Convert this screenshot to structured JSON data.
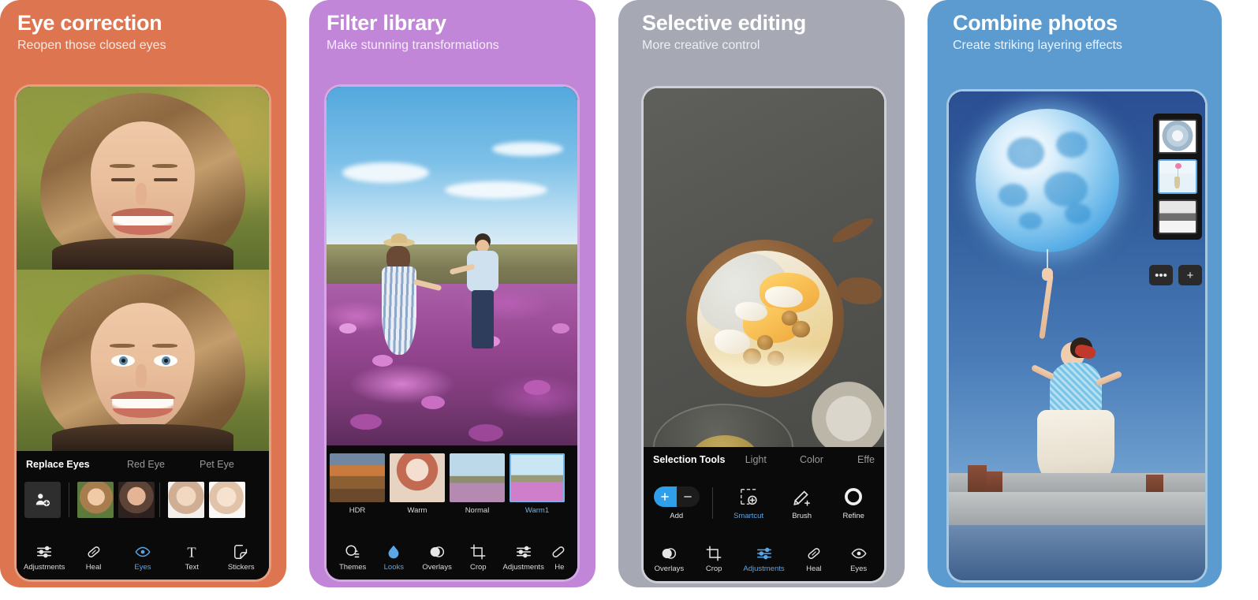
{
  "theme": {
    "card1_bg": "#dd7650",
    "card2_bg": "#c186d8",
    "card3_bg": "#a6a9b4",
    "card4_bg": "#5b9bd0",
    "accent_blue": "#5aa7e8",
    "panel_black": "#0a0a0a"
  },
  "cards": [
    {
      "id": "eye-correction",
      "title": "Eye correction",
      "subtitle": "Reopen those closed eyes",
      "tool_tabs": [
        {
          "label": "Replace Eyes",
          "active": true
        },
        {
          "label": "Red Eye",
          "active": false
        },
        {
          "label": "Pet Eye",
          "active": false
        }
      ],
      "add_button_icon": "add-person-icon",
      "thumbnails": [
        "face-thumb-1",
        "face-thumb-2",
        "face-thumb-3",
        "face-thumb-4"
      ],
      "nav": [
        {
          "label": "Adjustments",
          "icon": "sliders-icon",
          "selected": false
        },
        {
          "label": "Heal",
          "icon": "bandage-icon",
          "selected": false
        },
        {
          "label": "Eyes",
          "icon": "eye-icon",
          "selected": true
        },
        {
          "label": "Text",
          "icon": "text-icon",
          "selected": false
        },
        {
          "label": "Stickers",
          "icon": "sticker-icon",
          "selected": false
        }
      ]
    },
    {
      "id": "filter-library",
      "title": "Filter library",
      "subtitle": "Make stunning transformations",
      "filters": [
        {
          "label": "HDR",
          "selected": false
        },
        {
          "label": "Warm",
          "selected": false
        },
        {
          "label": "Normal",
          "selected": false
        },
        {
          "label": "Warm1",
          "selected": true
        }
      ],
      "nav": [
        {
          "label": "Themes",
          "icon": "themes-icon",
          "selected": false
        },
        {
          "label": "Looks",
          "icon": "looks-icon",
          "selected": true
        },
        {
          "label": "Overlays",
          "icon": "overlays-icon",
          "selected": false
        },
        {
          "label": "Crop",
          "icon": "crop-icon",
          "selected": false
        },
        {
          "label": "Adjustments",
          "icon": "sliders-icon",
          "selected": false
        },
        {
          "label": "He",
          "icon": "bandage-icon",
          "selected": false
        }
      ]
    },
    {
      "id": "selective-editing",
      "title": "Selective editing",
      "subtitle": "More creative control",
      "tool_tabs": [
        {
          "label": "Selection Tools",
          "active": true
        },
        {
          "label": "Light",
          "active": false
        },
        {
          "label": "Color",
          "active": false
        },
        {
          "label": "Effe",
          "active": false
        }
      ],
      "selection_tools": [
        {
          "label": "Add",
          "icon": "add-subtract-toggle-icon",
          "selected": false
        },
        {
          "label": "Smartcut",
          "icon": "smartcut-icon",
          "selected": true
        },
        {
          "label": "Brush",
          "icon": "brush-icon",
          "selected": false
        },
        {
          "label": "Refine",
          "icon": "refine-circle-icon",
          "selected": false
        }
      ],
      "nav": [
        {
          "label": "Overlays",
          "icon": "overlays-icon",
          "selected": false
        },
        {
          "label": "Crop",
          "icon": "crop-icon",
          "selected": false
        },
        {
          "label": "Adjustments",
          "icon": "sliders-icon",
          "selected": true
        },
        {
          "label": "Heal",
          "icon": "bandage-icon",
          "selected": false
        },
        {
          "label": "Eyes",
          "icon": "eye-icon",
          "selected": false
        }
      ]
    },
    {
      "id": "combine-photos",
      "title": "Combine photos",
      "subtitle": "Create striking layering effects",
      "layers": [
        {
          "name": "layer-moon",
          "selected": false
        },
        {
          "name": "layer-woman-balloon",
          "selected": true
        },
        {
          "name": "layer-rooftop",
          "selected": false
        }
      ],
      "layer_buttons": [
        {
          "label": "•••",
          "name": "more-options-button"
        },
        {
          "label": "+",
          "name": "add-layer-button"
        }
      ]
    }
  ]
}
